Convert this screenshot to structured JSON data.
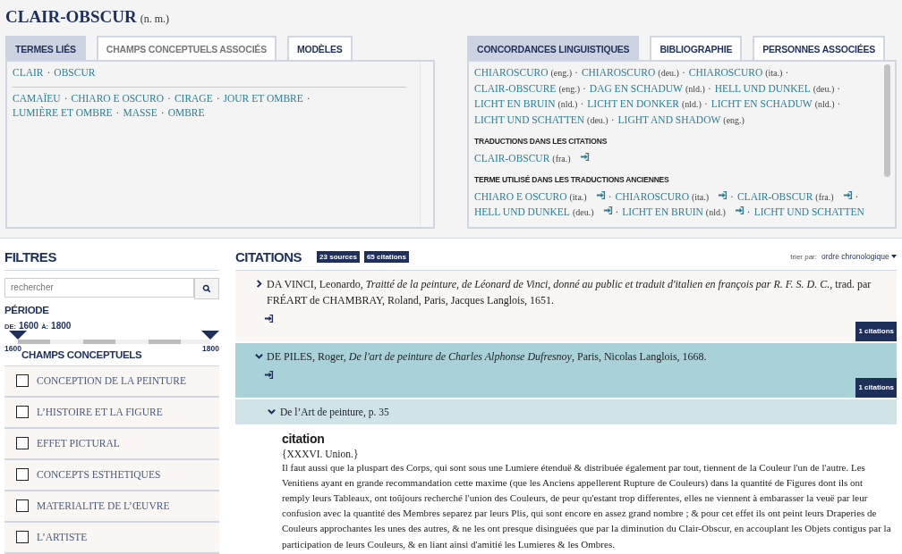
{
  "title": {
    "term": "CLAIR-OBSCUR",
    "grammar": "(n. m.)"
  },
  "left_panel": {
    "tabs": [
      {
        "label": "TERMES LIÉS",
        "selected": true,
        "disabled": false
      },
      {
        "label": "CHAMPS CONCEPTUELS ASSOCIÉS",
        "selected": false,
        "disabled": true
      },
      {
        "label": "MODÈLES",
        "selected": false,
        "disabled": false
      }
    ],
    "groups": [
      [
        {
          "term": "CLAIR",
          "sep": "·"
        },
        {
          "term": "OBSCUR"
        }
      ],
      [
        {
          "term": "CAMAÏEU",
          "sep": "·"
        },
        {
          "term": "CHIARO E OSCURO",
          "sep": "·"
        },
        {
          "term": "CIRAGE",
          "sep": "·"
        },
        {
          "term": "JOUR ET OMBRE",
          "sep": "·"
        },
        {
          "term": "LUMIÈRE ET OMBRE",
          "sep": "·"
        },
        {
          "term": "MASSE",
          "sep": "·"
        },
        {
          "term": "OMBRE"
        }
      ]
    ]
  },
  "right_panel": {
    "tabs": [
      {
        "label": "CONCORDANCES LINGUISTIQUES",
        "selected": true
      },
      {
        "label": "BIBLIOGRAPHIE",
        "selected": false
      },
      {
        "label": "PERSONNES ASSOCIÉES",
        "selected": false
      }
    ],
    "concordances": [
      {
        "term": "CHIAROSCURO",
        "lang": "(eng.)",
        "sep": "·"
      },
      {
        "term": "CHIAROSCURO",
        "lang": "(deu.)",
        "sep": "·"
      },
      {
        "term": "CHIAROSCURO",
        "lang": "(ita.)",
        "sep": "·"
      },
      {
        "term": "CLAIR-OBSCURE",
        "lang": "(eng.)",
        "sep": "·"
      },
      {
        "term": "DAG EN SCHADUW",
        "lang": "(nld.)",
        "sep": "·"
      },
      {
        "term": "HELL UND DUNKEL",
        "lang": "(deu.)",
        "sep": "·"
      },
      {
        "term": "LICHT EN BRUIN",
        "lang": "(nld.)",
        "sep": "·"
      },
      {
        "term": "LICHT EN DONKER",
        "lang": "(nld.)",
        "sep": "·"
      },
      {
        "term": "LICHT EN SCHADUW",
        "lang": "(nld.)",
        "sep": "·"
      },
      {
        "term": "LICHT UND SCHATTEN",
        "lang": "(deu.)",
        "sep": "·"
      },
      {
        "term": "LIGHT AND SHADOW",
        "lang": "(eng.)"
      }
    ],
    "sections": [
      {
        "heading": "TRADUCTIONS DANS LES CITATIONS",
        "items": [
          {
            "term": "CLAIR-OBSCUR",
            "lang": "(fra.)"
          }
        ]
      },
      {
        "heading": "TERME UTILISÉ DANS LES TRADUCTIONS ANCIENNES",
        "items": [
          {
            "term": "CHIARO E OSCURO",
            "lang": "(ita.)",
            "sep": "·"
          },
          {
            "term": "CHIAROSCURO",
            "lang": "(ita.)",
            "sep": "·"
          },
          {
            "term": "CLAIR-OBSCUR",
            "lang": "(fra.)",
            "sep": "·"
          },
          {
            "term": "HELL UND DUNKEL",
            "lang": "(deu.)",
            "sep": "·"
          },
          {
            "term": "LICHT EN BRUIN",
            "lang": "(nld.)",
            "sep": "·"
          },
          {
            "term": "LICHT UND SCHATTEN"
          }
        ]
      }
    ]
  },
  "filters": {
    "title": "FILTRES",
    "search": {
      "placeholder": "rechercher"
    },
    "period_heading": "PÉRIODE",
    "from_label": "DE:",
    "from": "1600",
    "to_label": "À:",
    "to": "1800",
    "range": {
      "thumbs": [
        {
          "level": 0
        },
        {
          "level": 1
        }
      ],
      "min_label": "1600",
      "max_label": "1800"
    },
    "concepts_heading": "CHAMPS CONCEPTUELS",
    "concepts": [
      {
        "label": "CONCEPTION DE LA PEINTURE",
        "checked": false
      },
      {
        "label": "L’HISTOIRE ET LA FIGURE",
        "checked": false
      },
      {
        "label": "EFFET PICTURAL",
        "checked": false
      },
      {
        "label": "CONCEPTS ESTHETIQUES",
        "checked": false
      },
      {
        "label": "MATERIALITE DE L’ŒUVRE",
        "checked": false
      },
      {
        "label": "L’ARTISTE",
        "checked": false
      }
    ]
  },
  "citations": {
    "title": "CITATIONS",
    "badges": [
      "23 sources",
      "65 citations"
    ],
    "sort_label": "trier par:",
    "sort_value": "ordre chronologique",
    "sources": [
      {
        "expanded": false,
        "reference": "DA VINCI, Leonardo, *Traitté de la peinture, de Léonard de Vinci, donné au public et traduit d'italien en françois par R. F. S. D. C.*, trad. par FRÉART de CHAMBRAY, Roland, Paris, Jacques Langlois, 1651.",
        "count": "1 citations"
      },
      {
        "expanded": true,
        "reference": "DE PILES, Roger, *De l'art de peinture de Charles Alphonse Dufresnoy*, Paris, Nicolas Langlois, 1668.",
        "count": "1 citations",
        "passages": [
          {
            "expanded": true,
            "label": "De l’Art de peinture, p. 35",
            "heading": "citation",
            "ref": "{XXXVI. Union.}",
            "text": "Il faut aussi que la pluspart des Corps, qui sont sous une Lumiere étenduë & distribuée également par tout, tiennent de la Couleur l'un de l'autre. Les Venitiens ayant en grande recommandation cette maxime (que les Anciens appellerent Rupture de Couleurs) dans la quantité de Figures dont ils ont remply leurs Tableaux, ont toûjours recherché l'union des Couleurs, de peur qu'estant trop differentes, elles ne viennent à embarasser la veuë par leur confusion avec la quantité des Membres separez par leurs Plis, qui sont encore en assez grand nombre ; & pour cet effet ils ont peint leurs Draperies de Couleurs approchantes les unes des autres, & ne les ont presque disinguées que par la diminution du Clair-Obscur, en accouplant les Objets contigus par la participation de leurs Couleurs, & en liant ainsi d'amitié les Lumieres & les Ombres."
          }
        ]
      }
    ]
  }
}
